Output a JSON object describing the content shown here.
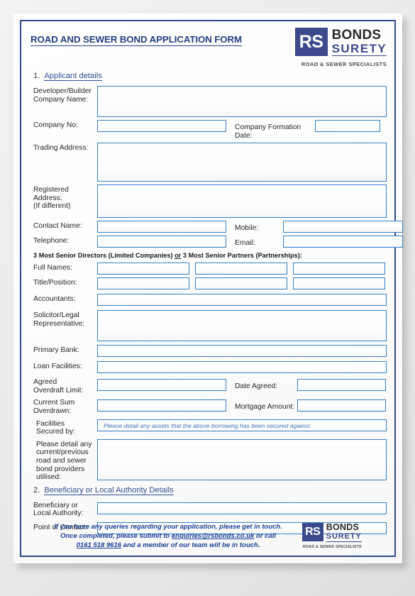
{
  "document": {
    "title": "ROAD AND SEWER BOND APPLICATION FORM"
  },
  "brand": {
    "monogram": "RS",
    "name_top": "BONDS",
    "name_bottom": "SURETY",
    "tagline": "ROAD & SEWER SPECIALISTS",
    "square_color": "#3c4a8c",
    "surety_color": "#3c4a8c",
    "bonds_color": "#2b2b2b"
  },
  "colors": {
    "title": "#22417f",
    "field_border": "#3580c4",
    "page_border": "#2d4a8a",
    "placeholder": "#4472b8",
    "footer_text": "#1b3f94"
  },
  "sections": {
    "applicant": {
      "number": "1.",
      "label": "Applicant details"
    },
    "beneficiary": {
      "number": "2.",
      "label": "Beneficiary or Local Authority Details"
    }
  },
  "labels": {
    "developer_company_name": "Developer/Builder\nCompany Name:",
    "developer_company_name_l1": "Developer/Builder",
    "developer_company_name_l2": "Company Name:",
    "company_no": "Company No:",
    "company_formation_date": "Company Formation Date:",
    "trading_address": "Trading Address:",
    "registered_address_l1": "Registered",
    "registered_address_l2": "Address:",
    "registered_address_l3": "(If different)",
    "contact_name": "Contact Name:",
    "mobile": "Mobile:",
    "telephone": "Telephone:",
    "email": "Email:",
    "directors_heading_pre": "3 Most Senior Directors (Limited Companies) ",
    "directors_heading_or": "or",
    "directors_heading_post": " 3 Most Senior Partners (Partnerships):",
    "full_names": "Full Names:",
    "title_position": "Title/Position:",
    "accountants": "Accountants:",
    "solicitor_l1": "Solicitor/Legal",
    "solicitor_l2": "Representative:",
    "primary_bank": "Primary Bank:",
    "loan_facilities": "Loan Facilities:",
    "agreed_overdraft_l1": "Agreed",
    "agreed_overdraft_l2": "Overdraft Limit:",
    "date_agreed": "Date Agreed:",
    "current_sum_l1": "Current Sum",
    "current_sum_l2": "Overdrawn:",
    "mortgage_amount": "Mortgage Amount:",
    "facilities_secured_l1": "Facilities",
    "facilities_secured_l2": "Secured by:",
    "bond_providers_l1": "Please detail any",
    "bond_providers_l2": "current/previous",
    "bond_providers_l3": "road and sewer",
    "bond_providers_l4": "bond providers",
    "bond_providers_l5": "utilised:",
    "beneficiary_l1": "Beneficiary or",
    "beneficiary_l2": "Local Authority:",
    "point_of_contact": "Point of Contact:"
  },
  "fields": {
    "developer_company_name": {
      "value": "",
      "placeholder": ""
    },
    "company_no": {
      "value": "",
      "placeholder": ""
    },
    "company_formation_date": {
      "value": "",
      "placeholder": ""
    },
    "trading_address": {
      "value": "",
      "placeholder": ""
    },
    "registered_address": {
      "value": "",
      "placeholder": ""
    },
    "contact_name": {
      "value": "",
      "placeholder": ""
    },
    "mobile": {
      "value": "",
      "placeholder": ""
    },
    "telephone": {
      "value": "",
      "placeholder": ""
    },
    "email": {
      "value": "",
      "placeholder": ""
    },
    "full_name_1": {
      "value": "",
      "placeholder": ""
    },
    "full_name_2": {
      "value": "",
      "placeholder": ""
    },
    "full_name_3": {
      "value": "",
      "placeholder": ""
    },
    "title_position_1": {
      "value": "",
      "placeholder": ""
    },
    "title_position_2": {
      "value": "",
      "placeholder": ""
    },
    "title_position_3": {
      "value": "",
      "placeholder": ""
    },
    "accountants": {
      "value": "",
      "placeholder": ""
    },
    "solicitor": {
      "value": "",
      "placeholder": ""
    },
    "primary_bank": {
      "value": "",
      "placeholder": ""
    },
    "loan_facilities": {
      "value": "",
      "placeholder": ""
    },
    "agreed_overdraft_limit": {
      "value": "",
      "placeholder": ""
    },
    "date_agreed": {
      "value": "",
      "placeholder": ""
    },
    "current_sum_overdrawn": {
      "value": "",
      "placeholder": ""
    },
    "mortgage_amount": {
      "value": "",
      "placeholder": ""
    },
    "facilities_secured_by": {
      "value": "",
      "placeholder": "Please detail any assets that the above borrowing has been secured against"
    },
    "bond_providers": {
      "value": "",
      "placeholder": ""
    },
    "beneficiary_authority": {
      "value": "",
      "placeholder": ""
    },
    "point_of_contact": {
      "value": "",
      "placeholder": ""
    }
  },
  "footer": {
    "line1": "If you have any queries regarding your application, please get in touch.",
    "line2_pre": "Once completed, please submit to ",
    "email_link": "enquiries@rsbonds.co.uk",
    "line2_post": " or call",
    "phone_link": "0161 518 9616",
    "line3_post": " and a member of our team will be in touch."
  }
}
